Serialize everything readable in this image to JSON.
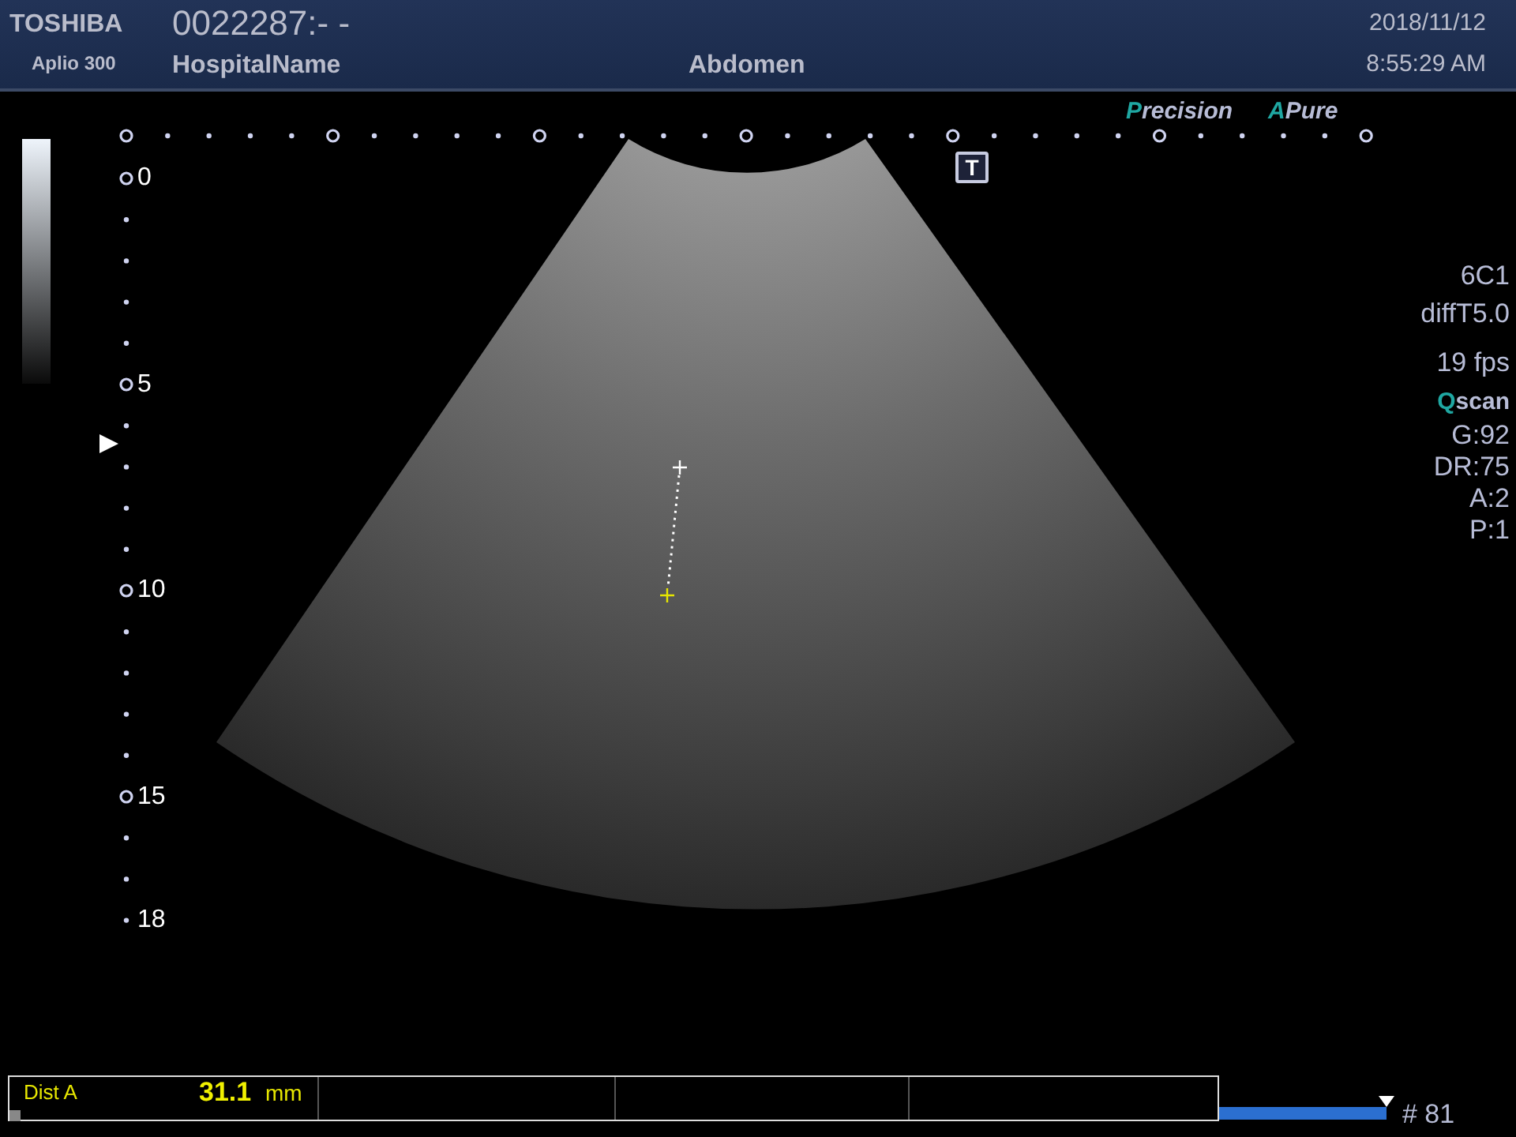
{
  "header": {
    "brand": "TOSHIBA",
    "model": "Aplio 300",
    "patient_id": "0022287:- -",
    "hospital": "HospitalName",
    "exam": "Abdomen",
    "date": "2018/11/12",
    "time": "8:55:29 AM"
  },
  "mode_logos": [
    {
      "accent": "P",
      "text": "recision"
    },
    {
      "accent": "A",
      "text": "Pure"
    }
  ],
  "transducer_marker": "T",
  "depth_scale": [
    "0",
    "5",
    "10",
    "15",
    "18"
  ],
  "parameters": [
    {
      "kind": "plain",
      "text": "6C1"
    },
    {
      "kind": "plain",
      "text": "diffT5.0"
    },
    {
      "kind": "gap",
      "text": "19 fps"
    },
    {
      "kind": "logo",
      "accent": "Q",
      "text": "scan"
    },
    {
      "kind": "plain",
      "text": "G:92"
    },
    {
      "kind": "plain",
      "text": "DR:75"
    },
    {
      "kind": "plain",
      "text": "A:2"
    },
    {
      "kind": "plain",
      "text": "P:1"
    }
  ],
  "measurement": {
    "label": "Dist A",
    "value": "31.1",
    "unit": "mm"
  },
  "cine": {
    "level": 1,
    "frame": "# 81"
  }
}
